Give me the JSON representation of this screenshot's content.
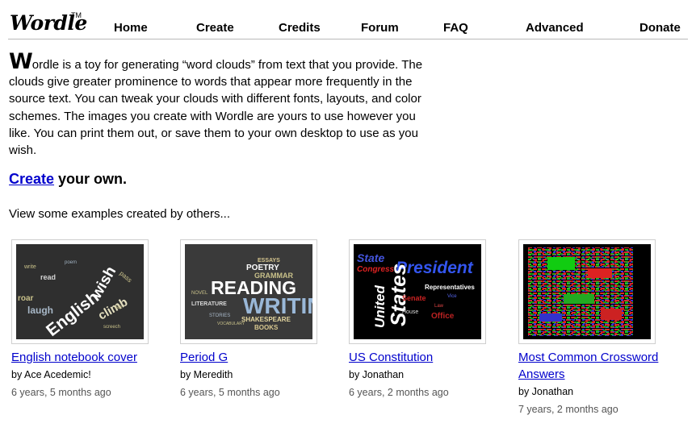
{
  "header": {
    "logo": "Wordle",
    "trademark": "TM",
    "nav": [
      {
        "label": "Home"
      },
      {
        "label": "Create"
      },
      {
        "label": "Credits"
      },
      {
        "label": "Forum"
      },
      {
        "label": "FAQ"
      },
      {
        "label": "Advanced"
      },
      {
        "label": "Donate"
      }
    ]
  },
  "intro": {
    "dropcap": "W",
    "text": "ordle is a toy for generating “word clouds” from text that you provide. The clouds give greater prominence to words that appear more frequently in the source text. You can tweak your clouds with different fonts, layouts, and color schemes. The images you create with Wordle are yours to use however you like. You can print them out, or save them to your own desktop to use as you wish."
  },
  "cta": {
    "link": "Create",
    "rest": " your own."
  },
  "examples_label": "View some examples created by others...",
  "gallery": [
    {
      "title": "English notebook cover",
      "author": "by Ace Acedemic!",
      "age": "6 years, 5 months ago"
    },
    {
      "title": "Period G",
      "author": "by Meredith",
      "age": "6 years, 5 months ago"
    },
    {
      "title": "US Constitution",
      "author": "by Jonathan",
      "age": "6 years, 2 months ago"
    },
    {
      "title": "Most Common Crossword Answers",
      "author": "by Jonathan",
      "age": "7 years, 2 months ago"
    }
  ]
}
